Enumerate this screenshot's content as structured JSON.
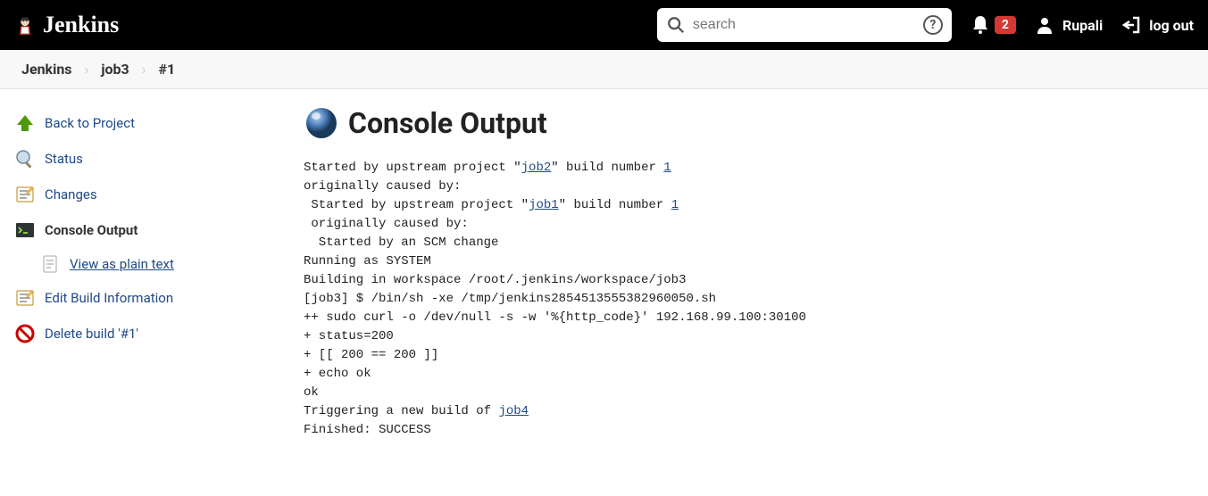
{
  "header": {
    "brand": "Jenkins",
    "search_placeholder": "search",
    "notif_count": "2",
    "username": "Rupali",
    "logout_label": "log out"
  },
  "breadcrumbs": [
    {
      "label": "Jenkins"
    },
    {
      "label": "job3"
    },
    {
      "label": "#1"
    }
  ],
  "sidebar": {
    "back": "Back to Project",
    "status": "Status",
    "changes": "Changes",
    "console": "Console Output",
    "plain": "View as plain text",
    "edit": "Edit Build Information",
    "delete": "Delete build '#1'"
  },
  "page": {
    "title": "Console Output"
  },
  "console": {
    "l1a": "Started by upstream project \"",
    "l1link": "job2",
    "l1b": "\" build number ",
    "l1num": "1",
    "l2": "originally caused by:",
    "l3a": " Started by upstream project \"",
    "l3link": "job1",
    "l3b": "\" build number ",
    "l3num": "1",
    "l4": " originally caused by:",
    "l5": "  Started by an SCM change",
    "l6": "Running as SYSTEM",
    "l7": "Building in workspace /root/.jenkins/workspace/job3",
    "l8": "[job3] $ /bin/sh -xe /tmp/jenkins2854513555382960050.sh",
    "l9": "++ sudo curl -o /dev/null -s -w '%{http_code}' 192.168.99.100:30100",
    "l10": "+ status=200",
    "l11": "+ [[ 200 == 200 ]]",
    "l12": "+ echo ok",
    "l13": "ok",
    "l14a": "Triggering a new build of ",
    "l14link": "job4",
    "l15": "Finished: SUCCESS"
  }
}
